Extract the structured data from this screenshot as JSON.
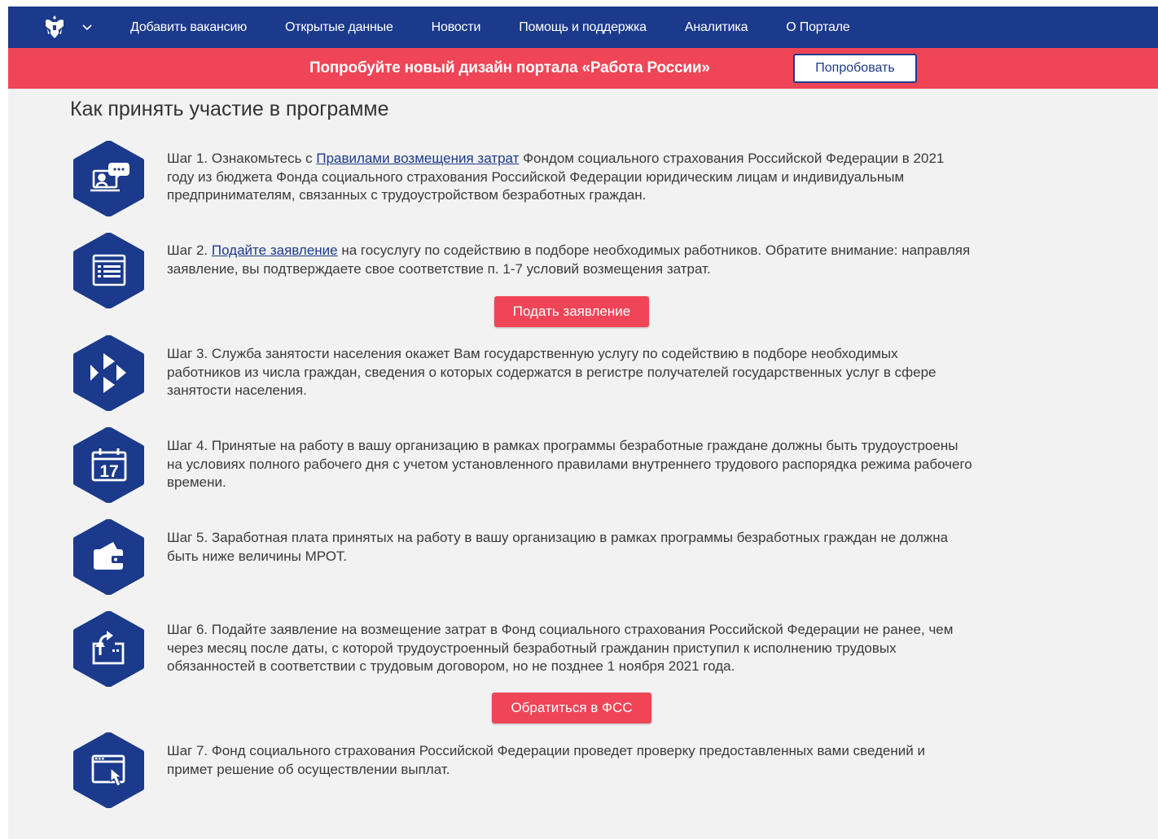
{
  "nav": {
    "emblem_icon": "russian-emblem-icon",
    "chevron_icon": "chevron-down-icon",
    "items": [
      {
        "label": "Добавить вакансию"
      },
      {
        "label": "Открытые данные"
      },
      {
        "label": "Новости"
      },
      {
        "label": "Помощь и поддержка"
      },
      {
        "label": "Аналитика"
      },
      {
        "label": "О Портале"
      }
    ]
  },
  "promo": {
    "text": "Попробуйте новый дизайн портала «Работа России»",
    "button_label": "Попробовать"
  },
  "main": {
    "heading": "Как принять участие в программе",
    "steps": [
      {
        "icon": "presentation-chat-icon",
        "prefix": "Шаг 1. Ознакомьтесь с ",
        "link": "Правилами возмещения затрат",
        "suffix": " Фондом социального страхования Российской Федерации в 2021 году из бюджета Фонда социального страхования Российской Федерации юридическим лицам и индивидуальным предпринимателям, связанных с трудоустройством безработных граждан."
      },
      {
        "icon": "form-list-icon",
        "prefix": "Шаг 2. ",
        "link": "Подайте заявление",
        "suffix": " на госуслугу по содействию в подборе необходимых работников. Обратите внимание: направляя заявление, вы подтверждаете свое соответствие п. 1-7 условий возмещения затрат.",
        "button_label": "Подать заявление"
      },
      {
        "icon": "employment-service-logo-icon",
        "text": "Шаг 3. Служба занятости населения окажет Вам государственную услугу по содействию в подборе необходимых работников из числа граждан, сведения о которых содержатся в регистре получателей государственных услуг в сфере занятости населения."
      },
      {
        "icon": "calendar-icon",
        "calendar_day": "17",
        "text": "Шаг 4. Принятые на работу в вашу организацию в рамках программы безработные граждане должны быть трудоустроены на условиях полного рабочего дня с учетом установленного правилами внутреннего трудового распорядка режима рабочего времени."
      },
      {
        "icon": "wallet-icon",
        "text": "Шаг 5. Заработная плата принятых на работу в вашу организацию в рамках программы безработных граждан не должна быть ниже величины МРОТ."
      },
      {
        "icon": "submit-upload-icon",
        "text": "Шаг 6. Подайте заявление на возмещение затрат в Фонд социального страхования Российской Федерации не ранее, чем через месяц после даты, с которой трудоустроенный безработный гражданин приступил к исполнению трудовых обязанностей в соответствии с трудовым договором, но не позднее 1 ноября 2021 года.",
        "button_label": "Обратиться в ФСС"
      },
      {
        "icon": "window-click-icon",
        "text": "Шаг 7. Фонд социального страхования Российской Федерации проведет проверку предоставленных вами сведений и примет решение об осуществлении выплат."
      }
    ]
  },
  "colors": {
    "nav_bg": "#1b3a8c",
    "promo_bg": "#f04557",
    "icon_bg": "#1b3a8c",
    "link": "#1b3a8c",
    "button_bg": "#f04557",
    "page_bg": "#f2f2f2"
  }
}
